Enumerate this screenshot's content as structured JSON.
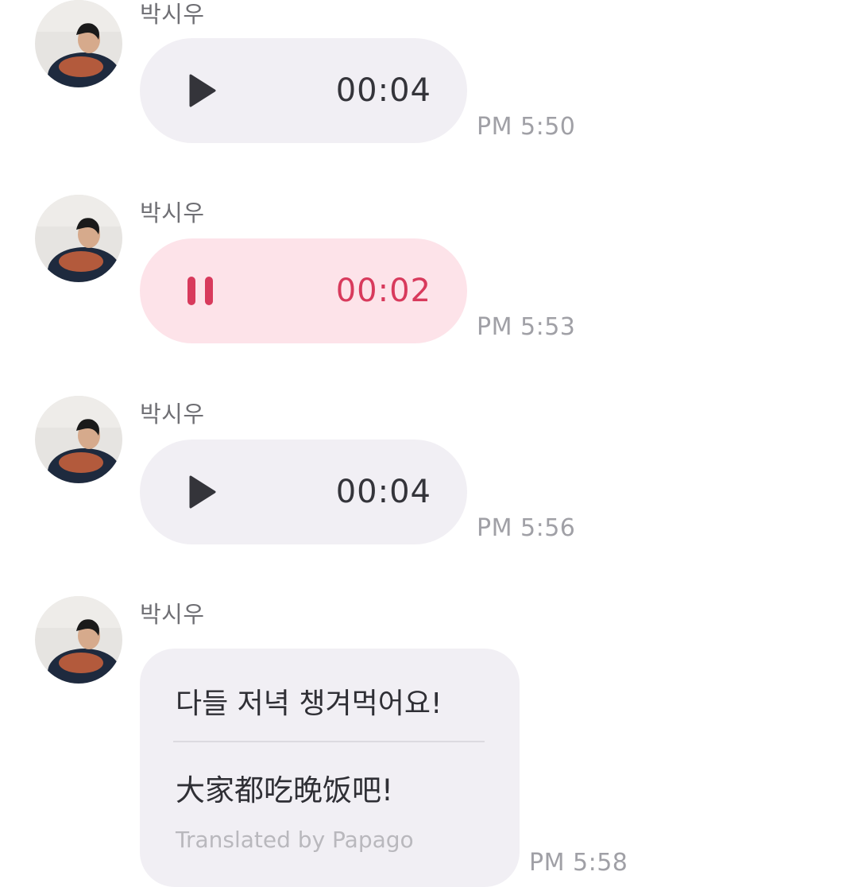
{
  "colors": {
    "bubble_default": "#f1eff4",
    "bubble_playing": "#fde3e9",
    "accent_playing": "#d83a5c",
    "timestamp": "#a0a0a6"
  },
  "messages": [
    {
      "sender": "박시우",
      "type": "voice",
      "state": "paused",
      "icon": "play-icon",
      "duration": "00:04",
      "time": "PM 5:50"
    },
    {
      "sender": "박시우",
      "type": "voice",
      "state": "playing",
      "icon": "pause-icon",
      "duration": "00:02",
      "time": "PM 5:53"
    },
    {
      "sender": "박시우",
      "type": "voice",
      "state": "paused",
      "icon": "play-icon",
      "duration": "00:04",
      "time": "PM 5:56"
    },
    {
      "sender": "박시우",
      "type": "text",
      "original": "다들 저녁 챙겨먹어요!",
      "translation": "大家都吃晚饭吧!",
      "credit": "Translated by Papago",
      "time": "PM 5:58"
    }
  ]
}
